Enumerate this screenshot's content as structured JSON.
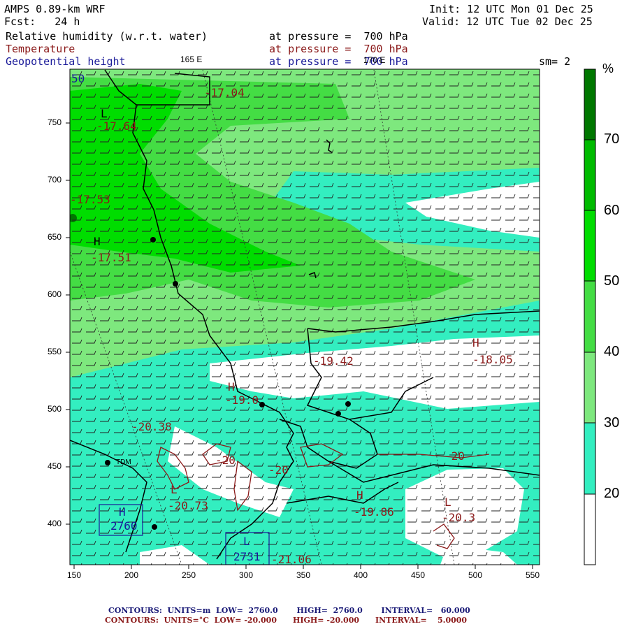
{
  "header": {
    "model": "AMPS 0.89-km WRF",
    "fcst": "Fcst:   24 h",
    "init": "Init: 12 UTC Mon 01 Dec 25",
    "valid": "Valid: 12 UTC Tue 02 Dec 25",
    "field1": "Relative humidity (w.r.t. water)",
    "field2": "Temperature",
    "field3": "Geopotential height",
    "pressure1": "at pressure =  700 hPa",
    "pressure2": "at pressure =  700 hPa",
    "pressure3": "at pressure =  700 hPa",
    "smoothing": "sm= 2"
  },
  "map": {
    "meridian_labels": [
      "165 E",
      "170 E"
    ],
    "x_ticks": [
      "150",
      "200",
      "250",
      "300",
      "350",
      "400",
      "450",
      "500",
      "550"
    ],
    "y_ticks": [
      "400",
      "450",
      "500",
      "550",
      "600",
      "650",
      "700",
      "750"
    ],
    "station_label": "TDM",
    "annotations": [
      {
        "text": "-17.04"
      },
      {
        "text": "L"
      },
      {
        "text": "-17.64"
      },
      {
        "text": "-17.53"
      },
      {
        "text": "H"
      },
      {
        "text": "-17.51"
      },
      {
        "text": "-19.42"
      },
      {
        "text": "H"
      },
      {
        "text": "-18.05"
      },
      {
        "text": "H"
      },
      {
        "text": "-19.0"
      },
      {
        "text": "-20.38"
      },
      {
        "text": "-20"
      },
      {
        "text": "-20"
      },
      {
        "text": "-20"
      },
      {
        "text": "L"
      },
      {
        "text": "-20.73"
      },
      {
        "text": "H"
      },
      {
        "text": "-19.86"
      },
      {
        "text": "L"
      },
      {
        "text": "-20.3"
      },
      {
        "text": "H"
      },
      {
        "text": "2760"
      },
      {
        "text": "L"
      },
      {
        "text": "2731"
      },
      {
        "text": "-21.06"
      },
      {
        "text": "50"
      }
    ]
  },
  "colorbar": {
    "unit": "%",
    "labels": [
      "20",
      "30",
      "40",
      "50",
      "60",
      "70"
    ],
    "colors": [
      "#ffffff",
      "#33eec0",
      "#7ee87e",
      "#44dd44",
      "#00dd00",
      "#007700"
    ]
  },
  "footer": {
    "line1": "CONTOURS:  UNITS=m  LOW=  2760.0       HIGH=  2760.0       INTERVAL=   60.000",
    "line2": "CONTOURS:  UNITS=°C  LOW= -20.000      HIGH= -20.000      INTERVAL=    5.0000",
    "color1": "#1a1a77",
    "color2": "#8b1a1a"
  }
}
